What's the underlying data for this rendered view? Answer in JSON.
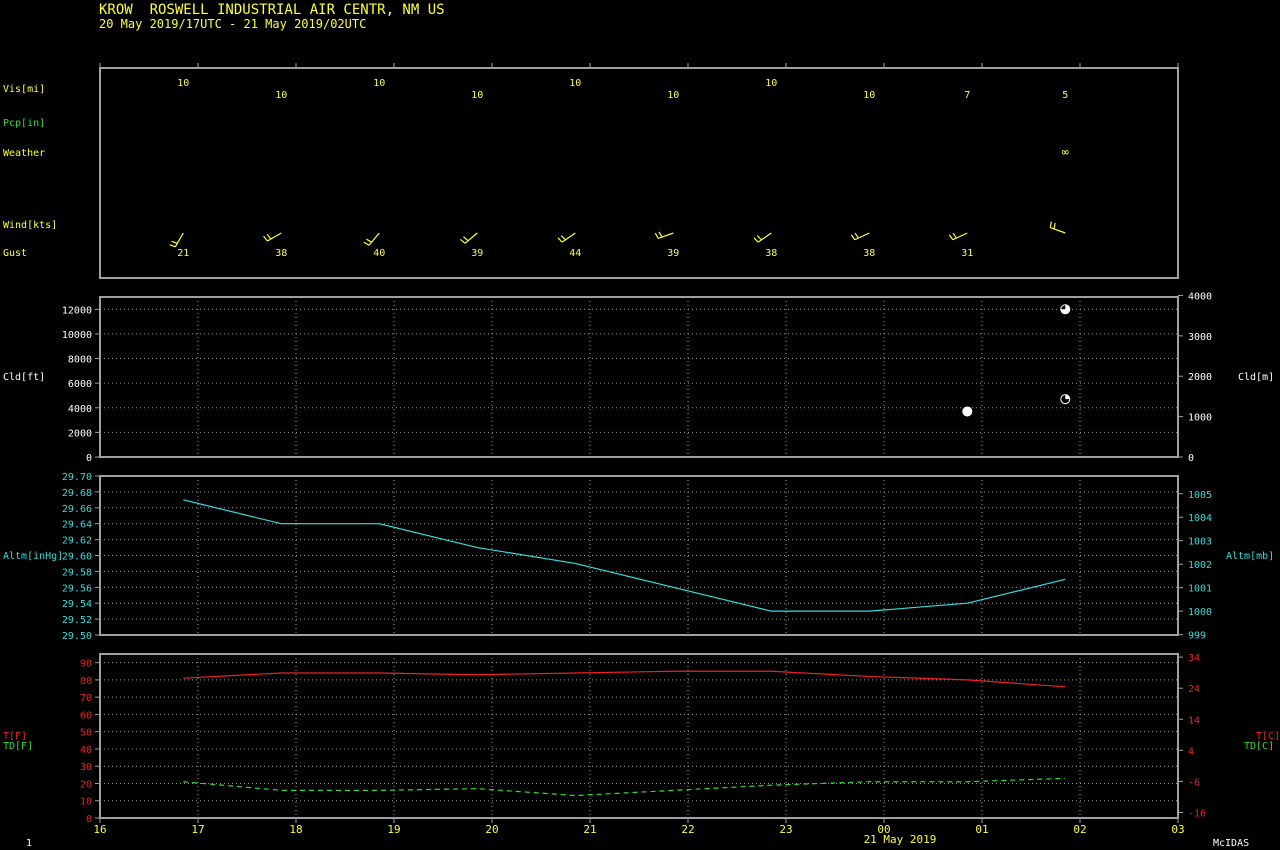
{
  "header": {
    "title": "KROW  ROSWELL INDUSTRIAL AIR CENTR, NM US",
    "range": "20 May 2019/17UTC - 21 May 2019/02UTC"
  },
  "footer": {
    "frame": "1",
    "brand": "McIDAS",
    "date": "21 May 2019"
  },
  "colors": {
    "frame": "#a0a0a0",
    "grid": "#9a9a9a",
    "label_yellow": "#ffff33",
    "cyan": "#33dddd",
    "red": "#ee2222",
    "green": "#33dd33",
    "white": "#ffffff"
  },
  "chart_data": {
    "type": "line",
    "x_axis": {
      "ticks": [
        16,
        17,
        18,
        19,
        20,
        21,
        22,
        23,
        0,
        1,
        2,
        3
      ],
      "tick_labels": [
        "16",
        "17",
        "18",
        "19",
        "20",
        "21",
        "22",
        "23",
        "00",
        "01",
        "02",
        "03"
      ]
    },
    "observations_x": [
      16.85,
      17.85,
      18.85,
      19.85,
      20.85,
      21.85,
      22.85,
      23.85,
      24.85,
      25.85
    ],
    "surface_panel": {
      "labels": {
        "vis": "Vis[mi]",
        "pcp": "Pcp[in]",
        "weather": "Weather",
        "wind": "Wind[kts]",
        "gust": "Gust"
      },
      "visibility": [
        "10",
        "10",
        "10",
        "10",
        "10",
        "10",
        "10",
        "10",
        "7",
        "5"
      ],
      "weather": [
        "",
        "",
        "",
        "",
        "",
        "",
        "",
        "",
        "",
        "∞"
      ],
      "wind_dir_deg": [
        210,
        240,
        220,
        230,
        235,
        250,
        235,
        245,
        245,
        290
      ],
      "gust": [
        "21",
        "38",
        "40",
        "39",
        "44",
        "39",
        "38",
        "38",
        "31",
        ""
      ]
    },
    "cloud_panel": {
      "ylabel_left": "Cld[ft]",
      "ylabel_right": "Cld[m]",
      "ylim": [
        0,
        13000
      ],
      "left_ticks": [
        0,
        2000,
        4000,
        6000,
        8000,
        10000,
        12000
      ],
      "right_ticks_m": [
        0,
        1000,
        2000,
        3000,
        4000
      ],
      "points": [
        {
          "x": 24.85,
          "height_ft": 3700,
          "cover": "full"
        },
        {
          "x": 25.85,
          "height_ft": 12000,
          "cover": "three-quarter"
        },
        {
          "x": 25.85,
          "height_ft": 4700,
          "cover": "quarter"
        }
      ]
    },
    "altimeter_panel": {
      "ylabel_left": "Altm[inHg]",
      "ylabel_right": "Altm[mb]",
      "ylim": [
        29.5,
        29.7
      ],
      "left_ticks": [
        "29.50",
        "29.52",
        "29.54",
        "29.56",
        "29.58",
        "29.60",
        "29.62",
        "29.64",
        "29.66",
        "29.68",
        "29.70"
      ],
      "right_ticks_mb": [
        999,
        1000,
        1001,
        1002,
        1003,
        1004,
        1005
      ],
      "values": [
        29.67,
        29.64,
        29.64,
        29.61,
        29.59,
        29.56,
        29.53,
        29.53,
        29.54,
        29.57
      ]
    },
    "temp_panel": {
      "ylabel_left_t": "T[F]",
      "ylabel_left_td": "TD[F]",
      "ylabel_right_t": "T[C]",
      "ylabel_right_td": "TD[C]",
      "ylim": [
        0,
        95
      ],
      "left_ticks": [
        0,
        10,
        20,
        30,
        40,
        50,
        60,
        70,
        80,
        90
      ],
      "right_ticks_c": [
        "-16",
        "-6",
        "4",
        "14",
        "24",
        "34"
      ],
      "series": [
        {
          "name": "T[F]",
          "values": [
            81,
            84,
            84,
            83,
            84,
            85,
            85,
            82,
            80,
            76
          ]
        },
        {
          "name": "TD[F]",
          "values": [
            21,
            16,
            16,
            17,
            13,
            16,
            19,
            21,
            21,
            23
          ]
        }
      ]
    }
  }
}
